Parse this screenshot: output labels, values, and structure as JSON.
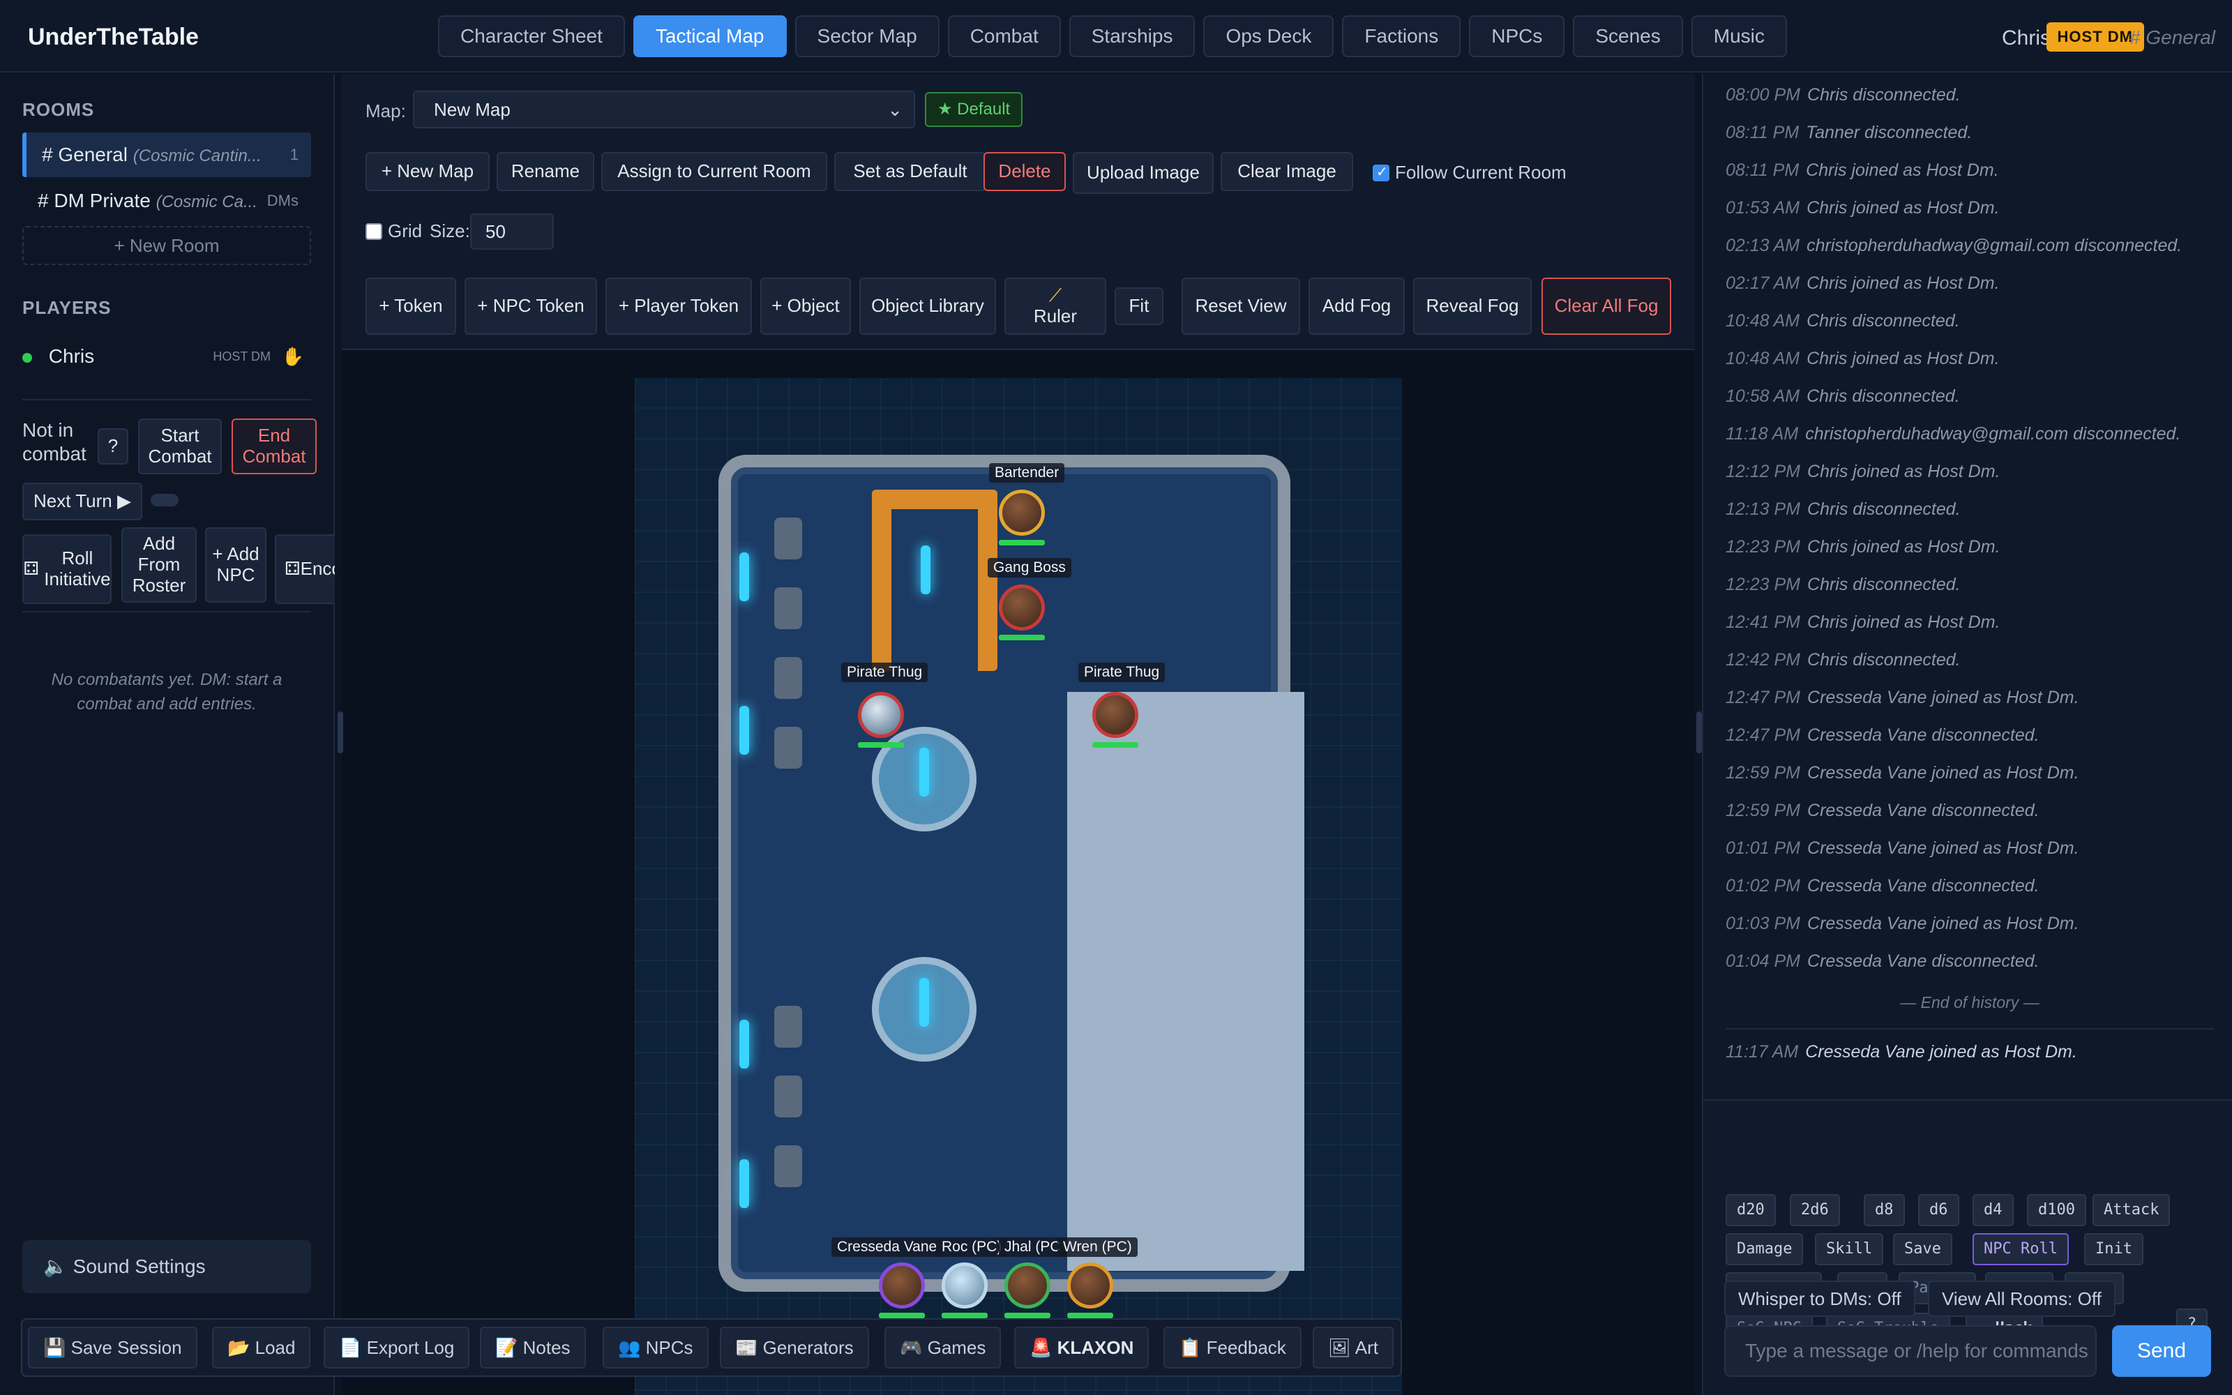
{
  "app": {
    "title": "UnderTheTable"
  },
  "tabs": [
    "Character Sheet",
    "Tactical Map",
    "Sector Map",
    "Combat",
    "Starships",
    "Ops Deck",
    "Factions",
    "NPCs",
    "Scenes",
    "Music"
  ],
  "active_tab": "Tactical Map",
  "header": {
    "user": "Chris",
    "badge": "HOST DM",
    "room": "# General"
  },
  "sidebar": {
    "rooms_heading": "ROOMS",
    "rooms": [
      {
        "name": "# General",
        "sub": "(Cosmic Cantin...",
        "count": "1"
      },
      {
        "name": "# DM Private",
        "sub": "(Cosmic Ca...",
        "count": "DMs"
      }
    ],
    "new_room": "+ New Room",
    "players_heading": "PLAYERS",
    "players": [
      {
        "name": "Chris",
        "role": "HOST DM"
      }
    ],
    "combat": {
      "status": "Not in combat",
      "help": "?",
      "start": "Start Combat",
      "end": "End Combat",
      "next_turn": "Next Turn ▶",
      "roll_initiative": "Roll Initiative",
      "add_from_roster": "Add From Roster",
      "add_npc": "+ Add NPC",
      "encounter": "Encou",
      "empty": "No combatants yet. DM: start a combat and add entries."
    },
    "sound_settings": "Sound Settings"
  },
  "map_toolbar": {
    "map_label": "Map:",
    "map_value": "New Map",
    "default_badge": "★ Default",
    "row1": [
      "+ New Map",
      "Rename",
      "Assign to Current Room",
      "Set as Default",
      "Delete",
      "Upload Image",
      "Clear Image"
    ],
    "follow_label": "Follow Current Room",
    "follow_checked": true,
    "grid_label": "Grid",
    "grid_checked": false,
    "size_label": "Size:",
    "size_value": "50",
    "row3": [
      "+ Token",
      "+ NPC Token",
      "+ Player Token",
      "+ Object",
      "Object Library",
      "Ruler",
      "Fit",
      "Reset View",
      "Add Fog",
      "Reveal Fog",
      "Clear All Fog"
    ]
  },
  "tokens": [
    {
      "label": "Bartender"
    },
    {
      "label": "Gang Boss"
    },
    {
      "label": "Pirate Thug"
    },
    {
      "label": "Pirate Thug"
    },
    {
      "label": "Cresseda Vane"
    },
    {
      "label": "Roc (PC)"
    },
    {
      "label": "Jhal (PC"
    },
    {
      "label": "Wren (PC)"
    }
  ],
  "bottom_bar": [
    "Save Session",
    "Load",
    "Export Log",
    "Notes",
    "NPCs",
    "Generators",
    "Games",
    "KLAXON",
    "Feedback",
    "Art"
  ],
  "log": [
    {
      "time": "08:00 PM",
      "text": "Chris disconnected."
    },
    {
      "time": "08:11 PM",
      "text": "Tanner disconnected."
    },
    {
      "time": "08:11 PM",
      "text": "Chris joined as Host Dm."
    },
    {
      "time": "01:53 AM",
      "text": "Chris joined as Host Dm."
    },
    {
      "time": "02:13 AM",
      "text": "christopherduhadway@gmail.com disconnected."
    },
    {
      "time": "02:17 AM",
      "text": "Chris joined as Host Dm."
    },
    {
      "time": "10:48 AM",
      "text": "Chris disconnected."
    },
    {
      "time": "10:48 AM",
      "text": "Chris joined as Host Dm."
    },
    {
      "time": "10:58 AM",
      "text": "Chris disconnected."
    },
    {
      "time": "11:18 AM",
      "text": "christopherduhadway@gmail.com disconnected."
    },
    {
      "time": "12:12 PM",
      "text": "Chris joined as Host Dm."
    },
    {
      "time": "12:13 PM",
      "text": "Chris disconnected."
    },
    {
      "time": "12:23 PM",
      "text": "Chris joined as Host Dm."
    },
    {
      "time": "12:23 PM",
      "text": "Chris disconnected."
    },
    {
      "time": "12:41 PM",
      "text": "Chris joined as Host Dm."
    },
    {
      "time": "12:42 PM",
      "text": "Chris disconnected."
    },
    {
      "time": "12:47 PM",
      "text": "Cresseda Vane joined as Host Dm."
    },
    {
      "time": "12:47 PM",
      "text": "Cresseda Vane disconnected."
    },
    {
      "time": "12:59 PM",
      "text": "Cresseda Vane joined as Host Dm."
    },
    {
      "time": "12:59 PM",
      "text": "Cresseda Vane disconnected."
    },
    {
      "time": "01:01 PM",
      "text": "Cresseda Vane joined as Host Dm."
    },
    {
      "time": "01:02 PM",
      "text": "Cresseda Vane disconnected."
    },
    {
      "time": "01:03 PM",
      "text": "Cresseda Vane joined as Host Dm."
    },
    {
      "time": "01:04 PM",
      "text": "Cresseda Vane disconnected."
    }
  ],
  "end_of_history": "— End of history —",
  "latest": {
    "time": "11:17 AM",
    "text": "Cresseda Vane joined as Host Dm."
  },
  "dice": {
    "row1": [
      "d20",
      "2d6",
      "d8",
      "d6",
      "d4",
      "d100",
      "Attack"
    ],
    "row2": [
      "Damage",
      "Skill",
      "Save",
      "NPC Roll",
      "Init"
    ],
    "row3": [
      "Reaction",
      "NPC",
      "Patron",
      "Urban",
      "Wild"
    ],
    "row4": [
      "SoG NPC",
      "SoG Trouble",
      "Hack"
    ],
    "help": "?"
  },
  "chat": {
    "whisper": "Whisper to DMs: Off",
    "view_all": "View All Rooms: Off",
    "placeholder": "Type a message or /help for commands",
    "send": "Send"
  }
}
